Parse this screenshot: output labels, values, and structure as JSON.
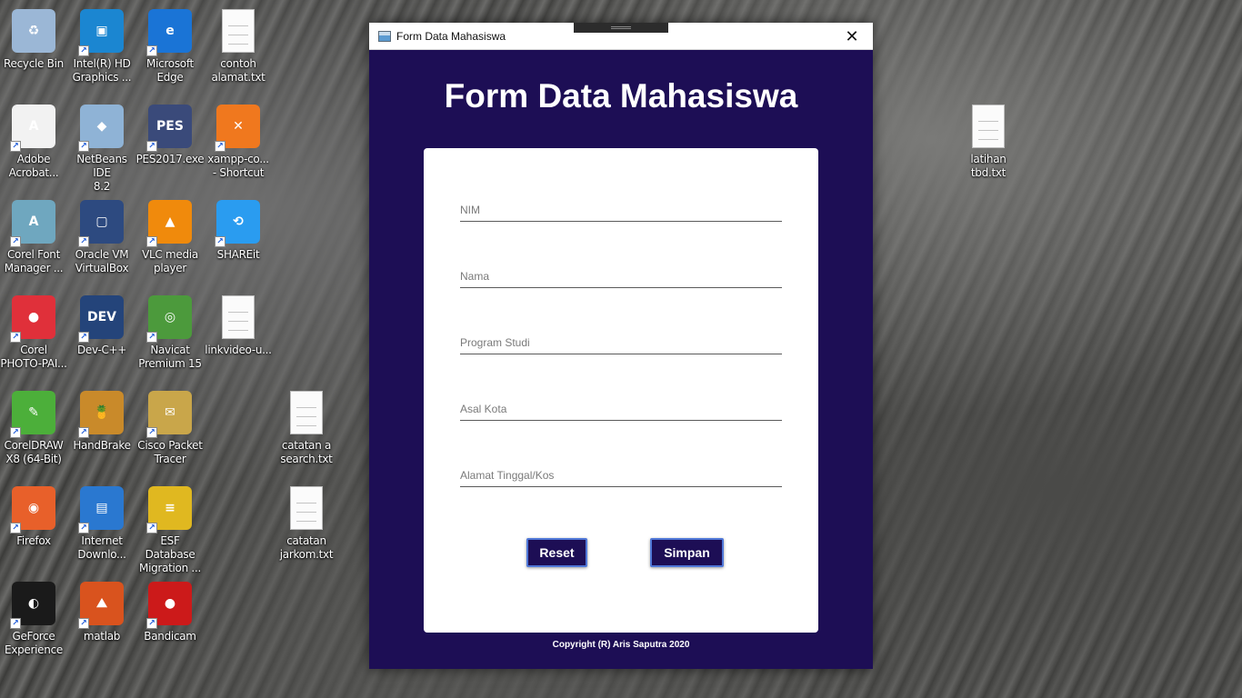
{
  "desktop": {
    "icons": [
      {
        "label": "Recycle Bin",
        "icon": "recycle-bin-icon",
        "color": "#9bb7d6",
        "glyph": "♻",
        "shortcut": false
      },
      {
        "label": "Intel(R) HD\nGraphics ...",
        "icon": "intel-graphics-icon",
        "color": "#1b86d1",
        "glyph": "▣",
        "shortcut": true
      },
      {
        "label": "Microsoft\nEdge",
        "icon": "edge-icon",
        "color": "#1a74d6",
        "glyph": "e",
        "shortcut": true
      },
      {
        "label": "contoh\nalamat.txt",
        "icon": "text-file-icon",
        "color": "#fbfbfb",
        "glyph": "",
        "shortcut": false
      },
      {
        "label": "Adobe\nAcrobat...",
        "icon": "acrobat-icon",
        "color": "#f2f2f2",
        "glyph": "A",
        "shortcut": true
      },
      {
        "label": "NetBeans IDE\n8.2",
        "icon": "netbeans-icon",
        "color": "#8fb3d6",
        "glyph": "◆",
        "shortcut": true
      },
      {
        "label": "PES2017.exe",
        "icon": "pes-game-icon",
        "color": "#3a4a7a",
        "glyph": "PES",
        "shortcut": true
      },
      {
        "label": "xampp-co...\n- Shortcut",
        "icon": "xampp-icon",
        "color": "#f0781e",
        "glyph": "✕",
        "shortcut": true
      },
      {
        "label": "Corel Font\nManager ...",
        "icon": "corel-font-icon",
        "color": "#6fa7bf",
        "glyph": "A",
        "shortcut": true
      },
      {
        "label": "Oracle VM\nVirtualBox",
        "icon": "virtualbox-icon",
        "color": "#2d4a80",
        "glyph": "▢",
        "shortcut": true
      },
      {
        "label": "VLC media\nplayer",
        "icon": "vlc-icon",
        "color": "#f08a0c",
        "glyph": "▲",
        "shortcut": true
      },
      {
        "label": "SHAREit",
        "icon": "shareit-icon",
        "color": "#2a9cf0",
        "glyph": "⟲",
        "shortcut": true
      },
      {
        "label": "Corel\nPHOTO-PAI...",
        "icon": "corel-photo-icon",
        "color": "#e0303a",
        "glyph": "●",
        "shortcut": true
      },
      {
        "label": "Dev-C++",
        "icon": "devcpp-icon",
        "color": "#24447a",
        "glyph": "DEV",
        "shortcut": true
      },
      {
        "label": "Navicat\nPremium 15",
        "icon": "navicat-icon",
        "color": "#4c9a3c",
        "glyph": "◎",
        "shortcut": true
      },
      {
        "label": "linkvideo-u...",
        "icon": "text-file-icon",
        "color": "#fbfbfb",
        "glyph": "",
        "shortcut": false
      },
      {
        "label": "CorelDRAW\nX8 (64-Bit)",
        "icon": "coreldraw-icon",
        "color": "#4caf3a",
        "glyph": "✎",
        "shortcut": true
      },
      {
        "label": "HandBrake",
        "icon": "handbrake-icon",
        "color": "#c98a2a",
        "glyph": "🍍",
        "shortcut": true
      },
      {
        "label": "Cisco Packet\nTracer",
        "icon": "packet-tracer-icon",
        "color": "#c9a64a",
        "glyph": "✉",
        "shortcut": true
      },
      {
        "label": "catatan a\nsearch.txt",
        "icon": "text-file-icon",
        "color": "#fbfbfb",
        "glyph": "",
        "shortcut": false
      },
      {
        "label": "Firefox",
        "icon": "firefox-icon",
        "color": "#e8602a",
        "glyph": "◉",
        "shortcut": true
      },
      {
        "label": "Internet\nDownlo...",
        "icon": "idm-icon",
        "color": "#2a78d0",
        "glyph": "▤",
        "shortcut": true
      },
      {
        "label": "ESF Database\nMigration ...",
        "icon": "esf-database-icon",
        "color": "#e0b820",
        "glyph": "≡",
        "shortcut": true
      },
      {
        "label": "catatan\njarkom.txt",
        "icon": "text-file-icon",
        "color": "#fbfbfb",
        "glyph": "",
        "shortcut": false
      },
      {
        "label": "GeForce\nExperience",
        "icon": "geforce-icon",
        "color": "#1a1a1a",
        "glyph": "◐",
        "shortcut": true
      },
      {
        "label": "matlab",
        "icon": "matlab-icon",
        "color": "#d9531e",
        "glyph": "⛰",
        "shortcut": true
      },
      {
        "label": "Bandicam",
        "icon": "bandicam-icon",
        "color": "#cc1a1a",
        "glyph": "●",
        "shortcut": true
      },
      {
        "label": "latihan\ntbd.txt",
        "icon": "text-file-icon",
        "color": "#fbfbfb",
        "glyph": "",
        "shortcut": false
      }
    ]
  },
  "window": {
    "title": "Form Data Mahasiswa",
    "close_glyph": "✕",
    "background": "#1d0e55"
  },
  "form": {
    "heading": "Form Data Mahasiswa",
    "fields": [
      {
        "placeholder": "NIM",
        "value": ""
      },
      {
        "placeholder": "Nama",
        "value": ""
      },
      {
        "placeholder": "Program Studi",
        "value": ""
      },
      {
        "placeholder": "Asal Kota",
        "value": ""
      },
      {
        "placeholder": "Alamat Tinggal/Kos",
        "value": ""
      }
    ],
    "reset_label": "Reset",
    "save_label": "Simpan"
  },
  "footer": {
    "copyright": "Copyright (R) Aris Saputra 2020"
  }
}
